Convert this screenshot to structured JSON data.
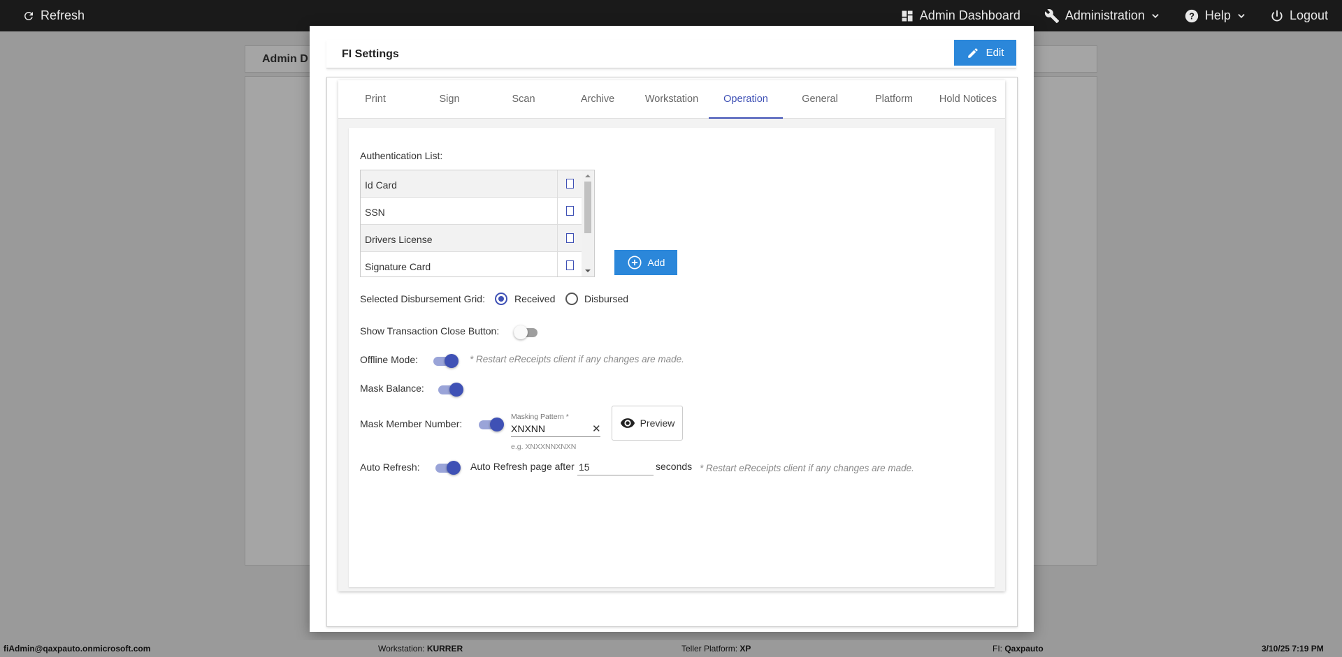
{
  "topbar": {
    "refresh_label": "Refresh",
    "admin_dashboard_label": "Admin Dashboard",
    "administration_label": "Administration",
    "help_label": "Help",
    "logout_label": "Logout"
  },
  "background": {
    "page_title": "Admin D"
  },
  "modal": {
    "title": "FI Settings",
    "edit_label": "Edit",
    "tabs": [
      {
        "label": "Print"
      },
      {
        "label": "Sign"
      },
      {
        "label": "Scan"
      },
      {
        "label": "Archive"
      },
      {
        "label": "Workstation"
      },
      {
        "label": "Operation"
      },
      {
        "label": "General"
      },
      {
        "label": "Platform"
      },
      {
        "label": "Hold Notices"
      }
    ],
    "active_tab": "Operation"
  },
  "operation": {
    "auth_list_label": "Authentication List:",
    "auth_items": [
      {
        "name": "Id Card",
        "checked": false
      },
      {
        "name": "SSN",
        "checked": false
      },
      {
        "name": "Drivers License",
        "checked": false
      },
      {
        "name": "Signature Card",
        "checked": false
      }
    ],
    "add_label": "Add",
    "disbursement_label": "Selected Disbursement Grid:",
    "received_label": "Received",
    "disbursed_label": "Disbursed",
    "disbursement_selected": "Received",
    "close_button_label": "Show Transaction Close Button:",
    "close_button_enabled": false,
    "offline_label": "Offline Mode:",
    "offline_enabled": true,
    "restart_hint": "* Restart eReceipts client if any changes are made.",
    "mask_balance_label": "Mask Balance:",
    "mask_balance_enabled": true,
    "mask_member_label": "Mask Member Number:",
    "mask_member_enabled": true,
    "masking_pattern_label": "Masking Pattern *",
    "masking_pattern_value": "XNXNN",
    "masking_pattern_example": "e.g. XNXXNNXNXN",
    "preview_label": "Preview",
    "auto_refresh_label": "Auto Refresh:",
    "auto_refresh_enabled": true,
    "auto_refresh_after_label": "Auto Refresh page after",
    "auto_refresh_value": "15",
    "seconds_label": "seconds"
  },
  "statusbar": {
    "user": "fiAdmin@qaxpauto.onmicrosoft.com",
    "workstation_label": "Workstation:",
    "workstation_value": "KURRER",
    "platform_label": "Teller Platform:",
    "platform_value": "XP",
    "fi_label": "FI:",
    "fi_value": "Qaxpauto",
    "datetime": "3/10/25 7:19 PM"
  },
  "colors": {
    "topbar_bg": "#1a1a1a",
    "overlay_bg": "#9a9a9a",
    "primary_button": "#2b87da",
    "accent": "#3f51b5"
  },
  "icons": [
    "refresh-icon",
    "dashboard-icon",
    "wrench-icon",
    "chevron-down-icon",
    "help-circle-icon",
    "power-icon",
    "pencil-icon",
    "plus-circle-icon",
    "eye-icon"
  ]
}
